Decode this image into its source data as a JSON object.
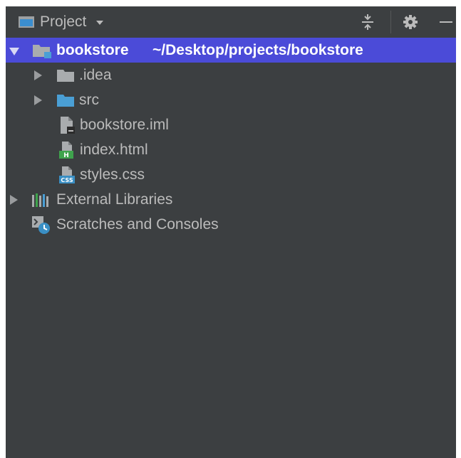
{
  "toolbar": {
    "title": "Project",
    "icons": [
      "collapse-all-icon",
      "gear-icon",
      "minimize-icon"
    ]
  },
  "tree": {
    "root": {
      "name": "bookstore",
      "path": "~/Desktop/projects/bookstore"
    },
    "children": [
      {
        "label": ".idea",
        "icon": "folder-icon"
      },
      {
        "label": "src",
        "icon": "source-folder-icon"
      },
      {
        "label": "bookstore.iml",
        "icon": "module-file-icon"
      },
      {
        "label": "index.html",
        "icon": "html-file-icon"
      },
      {
        "label": "styles.css",
        "icon": "css-file-icon"
      }
    ],
    "external_libraries": "External Libraries",
    "scratches": "Scratches and Consoles"
  },
  "colors": {
    "panel_bg": "#3c3f41",
    "selection": "#4b4bd8",
    "text": "#bbbbbb",
    "folder_gray": "#a9acae",
    "folder_blue": "#4a9fd5",
    "html_green": "#3fa34d",
    "css_blue": "#3a8fc4"
  }
}
